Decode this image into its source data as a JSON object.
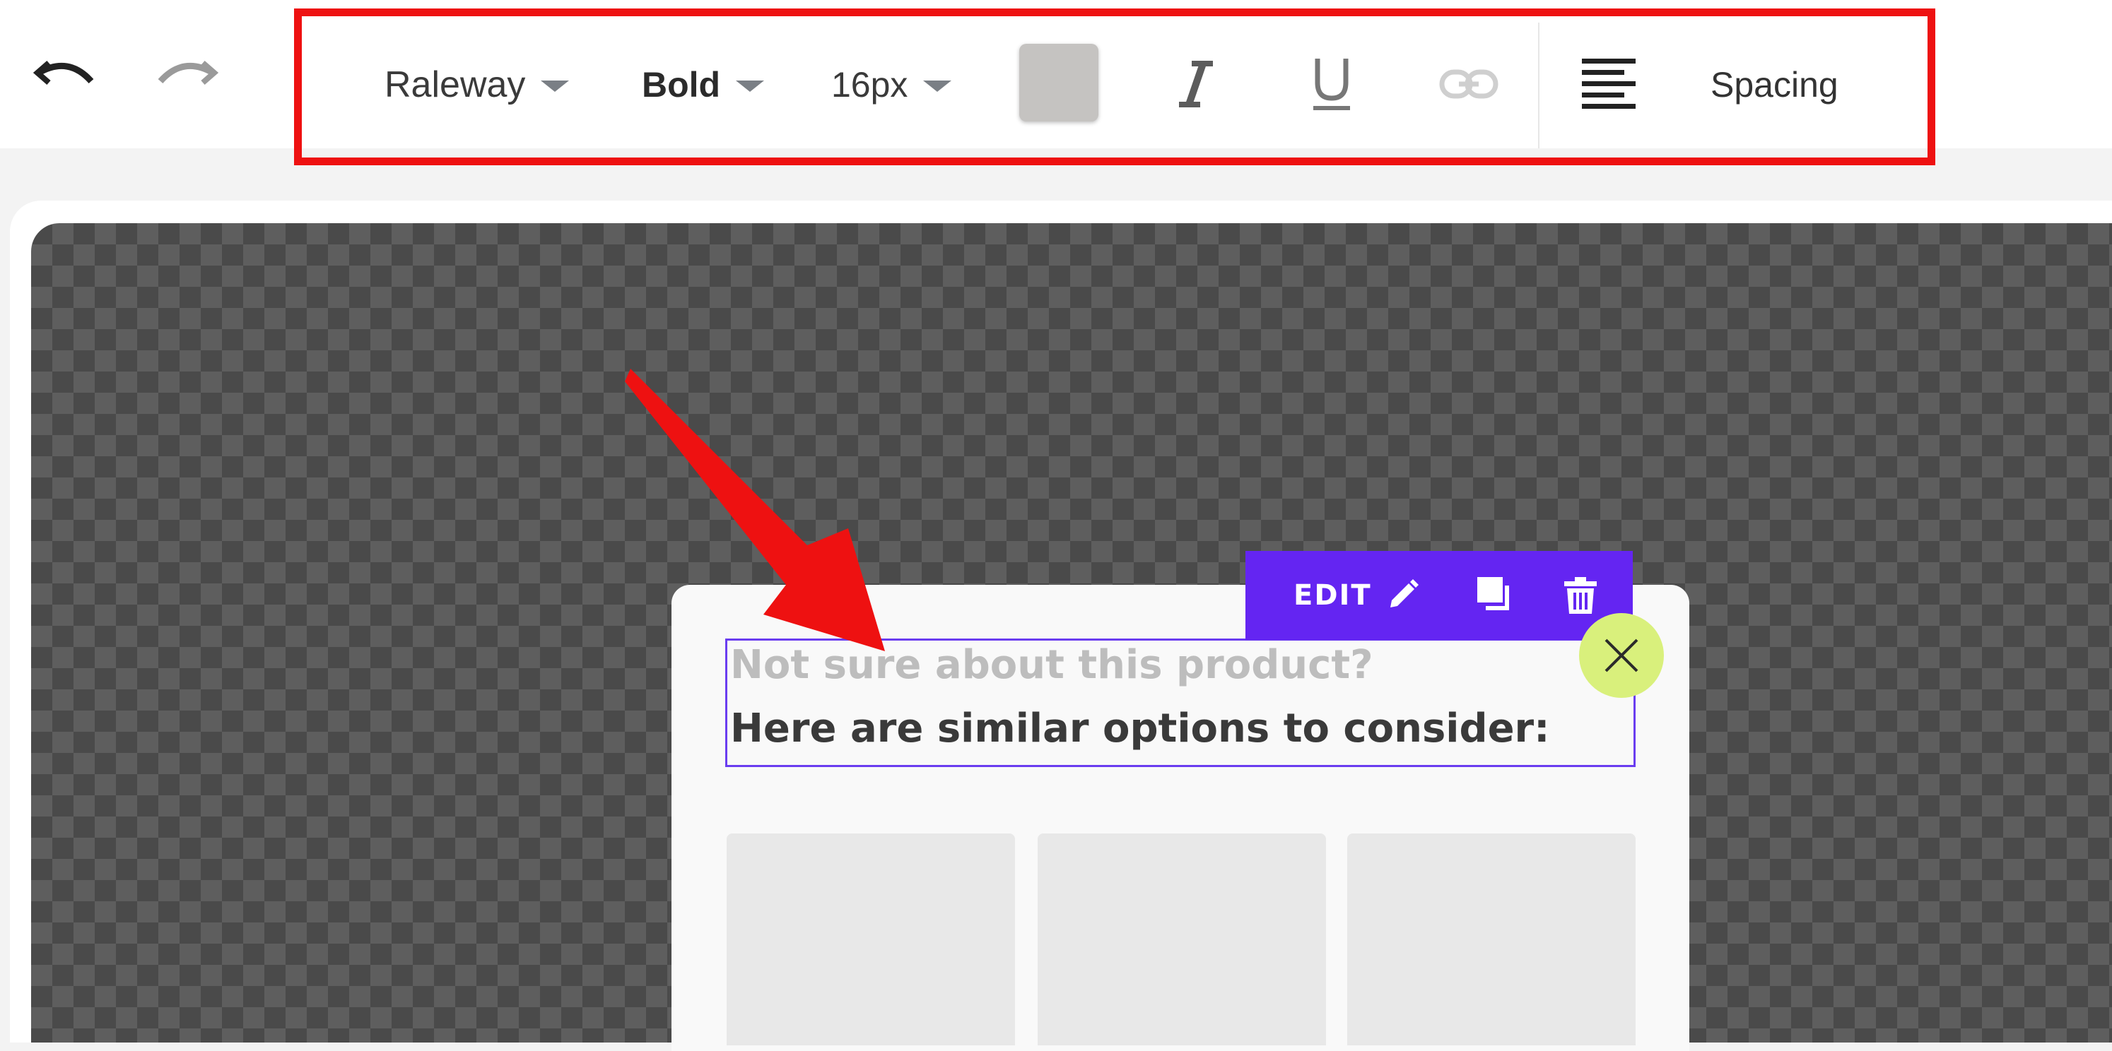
{
  "history": {
    "undo_icon": "undo-icon",
    "redo_icon": "redo-icon"
  },
  "format_bar": {
    "font_family": "Raleway",
    "font_weight": "Bold",
    "font_size": "16px",
    "text_color": "#c5c3c1",
    "italic_icon": "italic-icon",
    "underline_icon": "underline-icon",
    "link_icon": "link-icon",
    "align_icon": "align-left-icon",
    "spacing_label": "Spacing",
    "highlight_color": "#ee1111"
  },
  "editor": {
    "edit_label": "EDIT",
    "accent_color": "#6425f2",
    "close_circle_color": "#d9f07c"
  },
  "popup": {
    "heading_line1": "Not sure about this product?",
    "heading_line2": "Here are similar options to consider:",
    "product_cards": 3
  }
}
